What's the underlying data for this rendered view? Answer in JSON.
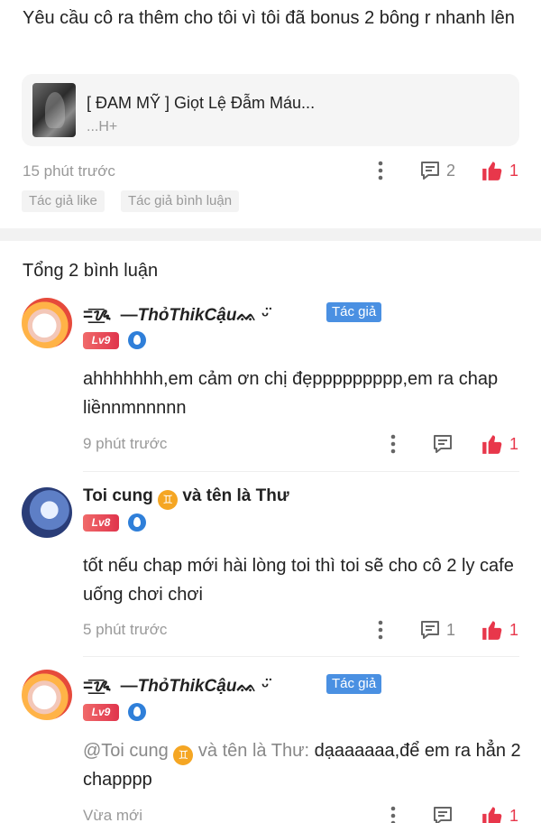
{
  "post": {
    "text": "Yêu cầu cô ra thêm cho tôi vì tôi đã bonus 2 bông r nhanh lên",
    "book": {
      "title": "[ ĐAM MỸ ] Giọt Lệ Đẫm Máu...",
      "subtitle": "...H+"
    },
    "time": "15 phút trước",
    "comment_count": "2",
    "like_count": "1",
    "tags": [
      "Tác giả like",
      "Tác giả bình luận"
    ]
  },
  "total_label": "Tổng 2 bình luận",
  "comments": [
    {
      "name_prefix": "=̲͟͞ᝰ",
      "name": "ThỏThikCậu",
      "name_suffix": "ᨐ ᵕ̈",
      "author_badge": "Tác giả",
      "level": "Lv9",
      "text": "ahhhhhhh,em cảm ơn chị đẹppppppppp,em ra chap liềnnmnnnnn",
      "time": "9 phút trước",
      "comment_count": "",
      "like_count": "1"
    },
    {
      "name": "Toi cung",
      "name_emoji": "♊",
      "name_rest": "và tên là Thư",
      "level": "Lv8",
      "text": "tốt nếu chap mới hài lòng toi thì toi sẽ cho cô 2 ly cafe uống chơi chơi",
      "time": "5 phút trước",
      "comment_count": "1",
      "like_count": "1"
    },
    {
      "name_prefix": "=̲͟͞ᝰ",
      "name": "ThỏThikCậu",
      "name_suffix": "ᨐ ᵕ̈",
      "author_badge": "Tác giả",
      "level": "Lv9",
      "reply_to": "@Toi cung",
      "reply_emoji": "♊",
      "reply_rest": "và tên là Thư:",
      "text": "dạaaaaaa,để em ra hẳn 2 chapppp",
      "time": "Vừa mới",
      "comment_count": "",
      "like_count": "1"
    }
  ],
  "colors": {
    "like": "#e8374b",
    "author_badge": "#4a90e2",
    "level": "#e0344c",
    "gem": "#2f7fd9"
  },
  "icons": [
    "more-vertical-icon",
    "comment-icon",
    "thumbs-up-icon",
    "gem-icon"
  ]
}
